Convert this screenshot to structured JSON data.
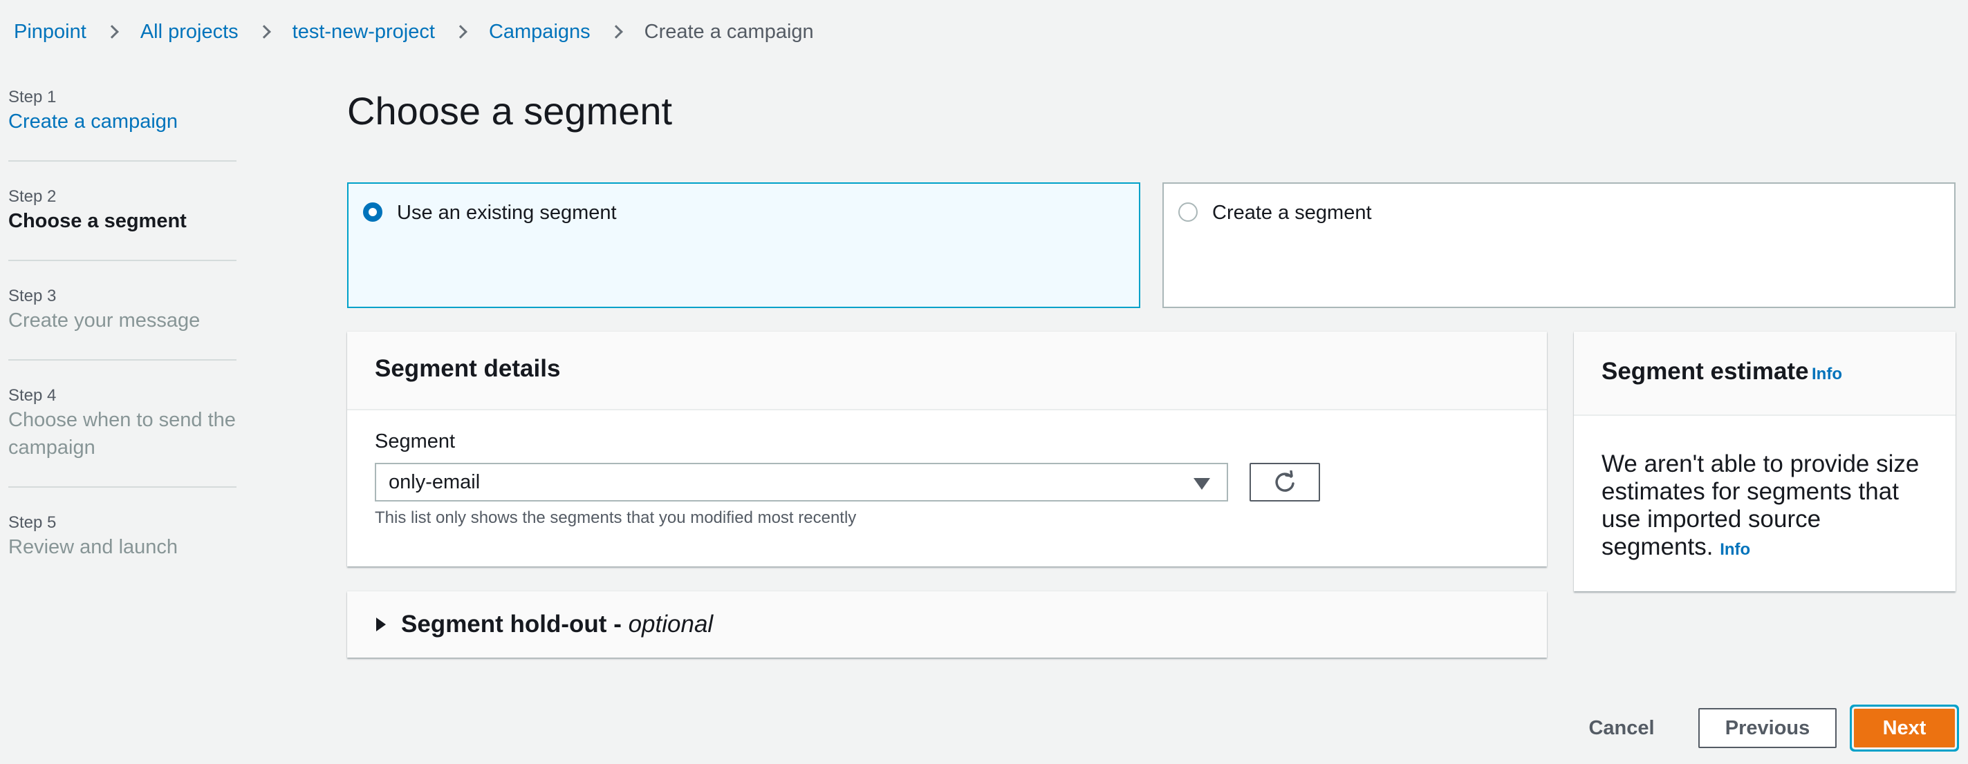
{
  "breadcrumb": {
    "items": [
      "Pinpoint",
      "All projects",
      "test-new-project",
      "Campaigns"
    ],
    "current": "Create a campaign"
  },
  "steps": [
    {
      "num": "Step 1",
      "label": "Create a campaign"
    },
    {
      "num": "Step 2",
      "label": "Choose a segment"
    },
    {
      "num": "Step 3",
      "label": "Create your message"
    },
    {
      "num": "Step 4",
      "label": "Choose when to send the campaign"
    },
    {
      "num": "Step 5",
      "label": "Review and launch"
    }
  ],
  "page": {
    "title": "Choose a segment"
  },
  "options": {
    "existing": "Use an existing segment",
    "create": "Create a segment"
  },
  "segment_details": {
    "title": "Segment details",
    "field_label": "Segment",
    "selected_value": "only-email",
    "hint": "This list only shows the segments that you modified most recently"
  },
  "holdout": {
    "title": "Segment hold-out - ",
    "optional": "optional"
  },
  "estimate": {
    "title": "Segment estimate",
    "info": "Info",
    "body": "We aren't able to provide size estimates for segments that use imported source segments.",
    "body_info": "Info"
  },
  "footer": {
    "cancel": "Cancel",
    "previous": "Previous",
    "next": "Next"
  }
}
